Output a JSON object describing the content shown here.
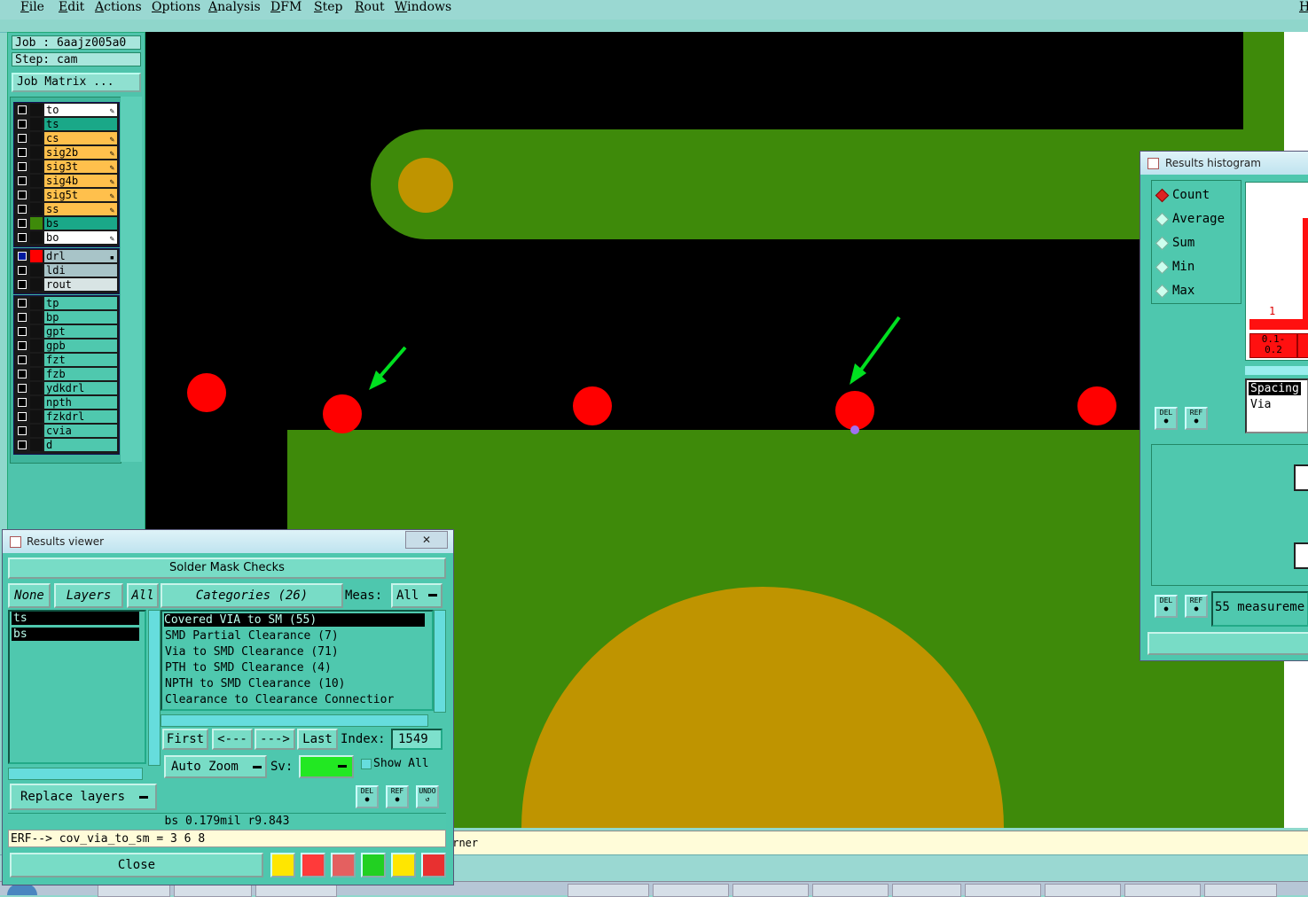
{
  "menu": [
    "File",
    "Edit",
    "Actions",
    "Options",
    "Analysis",
    "DFM",
    "Step",
    "Rout",
    "Windows"
  ],
  "menu_right": "H",
  "job": {
    "job_label": "Job : 6aajz005a0",
    "step_label": "Step: cam",
    "matrix_button": "Job Matrix ..."
  },
  "layers_group1": [
    {
      "name": "to",
      "color": "#ffffff",
      "icon": "edit-icon"
    },
    {
      "name": "ts",
      "color": "#1aa888",
      "icon": ""
    },
    {
      "name": "cs",
      "color": "#ffc04c",
      "icon": "edit-icon"
    },
    {
      "name": "sig2b",
      "color": "#ffc04c",
      "icon": "edit-icon"
    },
    {
      "name": "sig3t",
      "color": "#ffc04c",
      "icon": "edit-icon"
    },
    {
      "name": "sig4b",
      "color": "#ffc04c",
      "icon": "edit-icon"
    },
    {
      "name": "sig5t",
      "color": "#ffc04c",
      "icon": "edit-icon"
    },
    {
      "name": "ss",
      "color": "#ffc04c",
      "icon": "edit-icon"
    },
    {
      "name": "bs",
      "color": "#1aa888",
      "icon": ""
    },
    {
      "name": "bo",
      "color": "#ffffff",
      "icon": "edit-icon"
    }
  ],
  "layers_group2": [
    {
      "name": "drl",
      "color": "#a8c4c8",
      "icon": "grid-icon"
    },
    {
      "name": "ldi",
      "color": "#a8c4c8",
      "icon": ""
    },
    {
      "name": "rout",
      "color": "#d8e4e4",
      "icon": ""
    }
  ],
  "layers_group3": [
    "tp",
    "bp",
    "gpt",
    "gpb",
    "fzt",
    "fzb",
    "ydkdrl",
    "npth",
    "fzkdrl",
    "cvia",
    "d"
  ],
  "results_viewer": {
    "title": "Results viewer",
    "close_x": "✕",
    "header": "Solder Mask Checks",
    "none_label": "None",
    "layers_label": "Layers",
    "all_label": "All",
    "selected_layers": [
      "ts",
      "bs"
    ],
    "categories_label": "Categories (26)",
    "meas_label": "Meas:",
    "meas_value": "All",
    "categories": [
      "Covered VIA to SM (55)",
      "SMD Partial Clearance (7)",
      "Via to SMD Clearance (71)",
      "PTH to SMD Clearance (4)",
      "NPTH to SMD Clearance (10)",
      "Clearance to Clearance Connectior"
    ],
    "first": "First",
    "prev": "<---",
    "next": "--->",
    "last": "Last",
    "index_label": "Index:",
    "index_value": "1549",
    "auto_zoom": "Auto Zoom",
    "sv_label": "Sv:",
    "show_all": "Show All",
    "replace_layers": "Replace layers",
    "del": "DEL",
    "ref": "REF",
    "undo": "UNDO",
    "measurement": "bs 0.179mil   r9.843",
    "erf_line": "ERF--> cov_via_to_sm = 3 6 8",
    "close": "Close"
  },
  "histogram": {
    "title": "Results histogram",
    "options": [
      "Count",
      "Average",
      "Sum",
      "Min",
      "Max"
    ],
    "selected": "Count",
    "bar_value": "1",
    "bin_label": "0.1-\n0.2",
    "list_items": [
      "Spacing",
      "Via"
    ],
    "del": "DEL",
    "ref": "REF",
    "measurements": "55 measureme"
  },
  "status_text": "orner",
  "colors": {
    "copper": "#3e8a0a",
    "pad": "#bf9400",
    "drill": "#ff0000",
    "arrow": "#00e020",
    "panel": "#4ec7ae"
  }
}
